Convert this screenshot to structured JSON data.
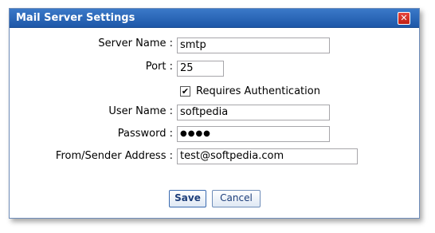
{
  "dialog": {
    "title": "Mail Server Settings",
    "close_glyph": "✕"
  },
  "form": {
    "server_name_label": "Server Name :",
    "server_name_value": "smtp",
    "port_label": "Port :",
    "port_value": "25",
    "requires_auth_label": "Requires Authentication",
    "requires_auth_checked": true,
    "user_name_label": "User Name :",
    "user_name_value": "softpedia",
    "password_label": "Password :",
    "password_value": "●●●●",
    "from_label": "From/Sender Address :",
    "from_value": "test@softpedia.com"
  },
  "buttons": {
    "save_label": "Save",
    "cancel_label": "Cancel"
  },
  "colors": {
    "titlebar": "#2e6bbd",
    "close": "#d63a2f",
    "button_text": "#1d3e7a"
  }
}
